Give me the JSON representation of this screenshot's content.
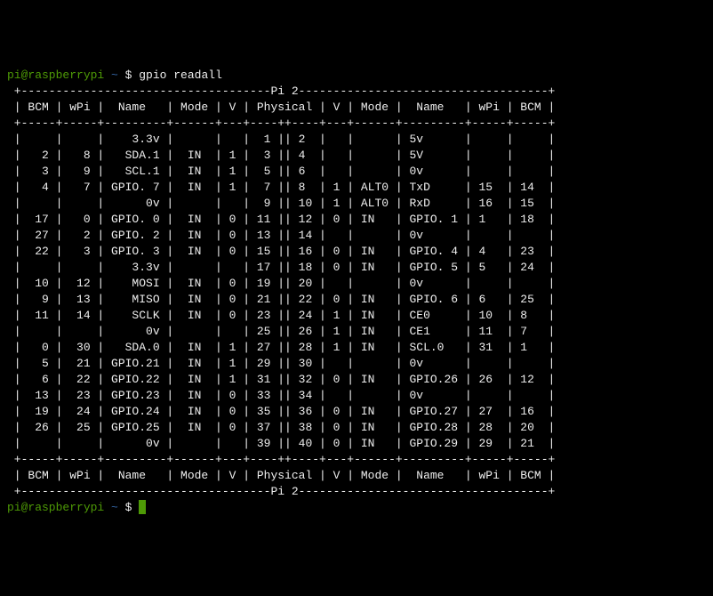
{
  "prompt": {
    "userhost": "pi@raspberrypi",
    "sep_space": " ",
    "cwd": "~",
    "dollar": " $ "
  },
  "command": "gpio readall",
  "board_label": "Pi 2",
  "headers": [
    "BCM",
    "wPi",
    "Name",
    "Mode",
    "V",
    "Physical",
    "V",
    "Mode",
    "Name",
    "wPi",
    "BCM"
  ],
  "footers": [
    "BCM",
    "wPi",
    "Name",
    "Mode",
    "V",
    "Physical",
    "V",
    "Mode",
    "Name",
    "wPi",
    "BCM"
  ],
  "rows": [
    {
      "l": {
        "bcm": "",
        "wpi": "",
        "name": "3.3v",
        "mode": "",
        "v": "",
        "phys": "1"
      },
      "r": {
        "phys": "2",
        "v": "",
        "mode": "",
        "name": "5v",
        "wpi": "",
        "bcm": ""
      }
    },
    {
      "l": {
        "bcm": "2",
        "wpi": "8",
        "name": "SDA.1",
        "mode": "IN",
        "v": "1",
        "phys": "3"
      },
      "r": {
        "phys": "4",
        "v": "",
        "mode": "",
        "name": "5V",
        "wpi": "",
        "bcm": ""
      }
    },
    {
      "l": {
        "bcm": "3",
        "wpi": "9",
        "name": "SCL.1",
        "mode": "IN",
        "v": "1",
        "phys": "5"
      },
      "r": {
        "phys": "6",
        "v": "",
        "mode": "",
        "name": "0v",
        "wpi": "",
        "bcm": ""
      }
    },
    {
      "l": {
        "bcm": "4",
        "wpi": "7",
        "name": "GPIO. 7",
        "mode": "IN",
        "v": "1",
        "phys": "7"
      },
      "r": {
        "phys": "8",
        "v": "1",
        "mode": "ALT0",
        "name": "TxD",
        "wpi": "15",
        "bcm": "14"
      }
    },
    {
      "l": {
        "bcm": "",
        "wpi": "",
        "name": "0v",
        "mode": "",
        "v": "",
        "phys": "9"
      },
      "r": {
        "phys": "10",
        "v": "1",
        "mode": "ALT0",
        "name": "RxD",
        "wpi": "16",
        "bcm": "15"
      }
    },
    {
      "l": {
        "bcm": "17",
        "wpi": "0",
        "name": "GPIO. 0",
        "mode": "IN",
        "v": "0",
        "phys": "11"
      },
      "r": {
        "phys": "12",
        "v": "0",
        "mode": "IN",
        "name": "GPIO. 1",
        "wpi": "1",
        "bcm": "18"
      }
    },
    {
      "l": {
        "bcm": "27",
        "wpi": "2",
        "name": "GPIO. 2",
        "mode": "IN",
        "v": "0",
        "phys": "13"
      },
      "r": {
        "phys": "14",
        "v": "",
        "mode": "",
        "name": "0v",
        "wpi": "",
        "bcm": ""
      }
    },
    {
      "l": {
        "bcm": "22",
        "wpi": "3",
        "name": "GPIO. 3",
        "mode": "IN",
        "v": "0",
        "phys": "15"
      },
      "r": {
        "phys": "16",
        "v": "0",
        "mode": "IN",
        "name": "GPIO. 4",
        "wpi": "4",
        "bcm": "23"
      }
    },
    {
      "l": {
        "bcm": "",
        "wpi": "",
        "name": "3.3v",
        "mode": "",
        "v": "",
        "phys": "17"
      },
      "r": {
        "phys": "18",
        "v": "0",
        "mode": "IN",
        "name": "GPIO. 5",
        "wpi": "5",
        "bcm": "24"
      }
    },
    {
      "l": {
        "bcm": "10",
        "wpi": "12",
        "name": "MOSI",
        "mode": "IN",
        "v": "0",
        "phys": "19"
      },
      "r": {
        "phys": "20",
        "v": "",
        "mode": "",
        "name": "0v",
        "wpi": "",
        "bcm": ""
      }
    },
    {
      "l": {
        "bcm": "9",
        "wpi": "13",
        "name": "MISO",
        "mode": "IN",
        "v": "0",
        "phys": "21"
      },
      "r": {
        "phys": "22",
        "v": "0",
        "mode": "IN",
        "name": "GPIO. 6",
        "wpi": "6",
        "bcm": "25"
      }
    },
    {
      "l": {
        "bcm": "11",
        "wpi": "14",
        "name": "SCLK",
        "mode": "IN",
        "v": "0",
        "phys": "23"
      },
      "r": {
        "phys": "24",
        "v": "1",
        "mode": "IN",
        "name": "CE0",
        "wpi": "10",
        "bcm": "8"
      }
    },
    {
      "l": {
        "bcm": "",
        "wpi": "",
        "name": "0v",
        "mode": "",
        "v": "",
        "phys": "25"
      },
      "r": {
        "phys": "26",
        "v": "1",
        "mode": "IN",
        "name": "CE1",
        "wpi": "11",
        "bcm": "7"
      }
    },
    {
      "l": {
        "bcm": "0",
        "wpi": "30",
        "name": "SDA.0",
        "mode": "IN",
        "v": "1",
        "phys": "27"
      },
      "r": {
        "phys": "28",
        "v": "1",
        "mode": "IN",
        "name": "SCL.0",
        "wpi": "31",
        "bcm": "1"
      }
    },
    {
      "l": {
        "bcm": "5",
        "wpi": "21",
        "name": "GPIO.21",
        "mode": "IN",
        "v": "1",
        "phys": "29"
      },
      "r": {
        "phys": "30",
        "v": "",
        "mode": "",
        "name": "0v",
        "wpi": "",
        "bcm": ""
      }
    },
    {
      "l": {
        "bcm": "6",
        "wpi": "22",
        "name": "GPIO.22",
        "mode": "IN",
        "v": "1",
        "phys": "31"
      },
      "r": {
        "phys": "32",
        "v": "0",
        "mode": "IN",
        "name": "GPIO.26",
        "wpi": "26",
        "bcm": "12"
      }
    },
    {
      "l": {
        "bcm": "13",
        "wpi": "23",
        "name": "GPIO.23",
        "mode": "IN",
        "v": "0",
        "phys": "33"
      },
      "r": {
        "phys": "34",
        "v": "",
        "mode": "",
        "name": "0v",
        "wpi": "",
        "bcm": ""
      }
    },
    {
      "l": {
        "bcm": "19",
        "wpi": "24",
        "name": "GPIO.24",
        "mode": "IN",
        "v": "0",
        "phys": "35"
      },
      "r": {
        "phys": "36",
        "v": "0",
        "mode": "IN",
        "name": "GPIO.27",
        "wpi": "27",
        "bcm": "16"
      }
    },
    {
      "l": {
        "bcm": "26",
        "wpi": "25",
        "name": "GPIO.25",
        "mode": "IN",
        "v": "0",
        "phys": "37"
      },
      "r": {
        "phys": "38",
        "v": "0",
        "mode": "IN",
        "name": "GPIO.28",
        "wpi": "28",
        "bcm": "20"
      }
    },
    {
      "l": {
        "bcm": "",
        "wpi": "",
        "name": "0v",
        "mode": "",
        "v": "",
        "phys": "39"
      },
      "r": {
        "phys": "40",
        "v": "0",
        "mode": "IN",
        "name": "GPIO.29",
        "wpi": "29",
        "bcm": "21"
      }
    }
  ],
  "col_widths": {
    "bcm": 5,
    "wpi": 5,
    "name": 9,
    "mode": 6,
    "v": 3,
    "physL": 4,
    "physR": 4
  }
}
